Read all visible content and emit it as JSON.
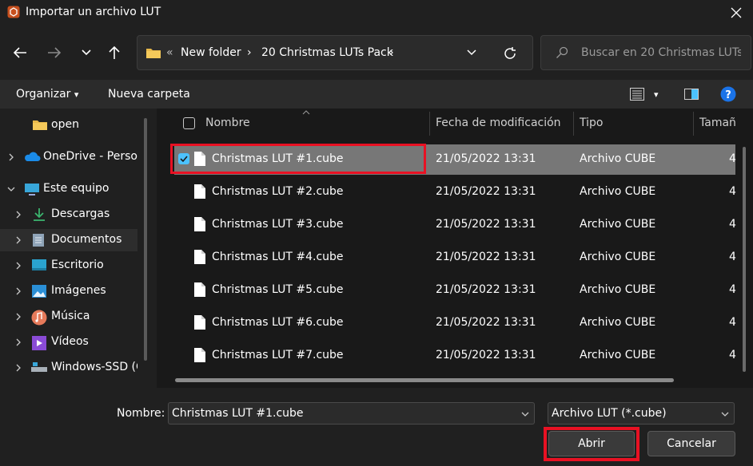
{
  "window": {
    "title": "Importar un archivo LUT",
    "icon": "app-logo-icon",
    "close_icon": "close-icon"
  },
  "nav": {
    "back_icon": "arrow-left-icon",
    "forward_icon": "arrow-right-icon",
    "recent_icon": "chevron-down-icon",
    "up_icon": "arrow-up-icon"
  },
  "address": {
    "overflow": "«",
    "crumbs": [
      "New folder",
      "20 Christmas LUTs Pack"
    ],
    "separator": "›",
    "dropdown_icon": "chevron-down-icon",
    "refresh_icon": "refresh-icon"
  },
  "search": {
    "placeholder": "Buscar en 20 Christmas LUTs ..."
  },
  "commands": {
    "organize": "Organizar",
    "organize_caret": "▾",
    "new_folder": "Nueva carpeta",
    "view_caret": "▾"
  },
  "sidebar": {
    "items": [
      {
        "label": "open",
        "icon": "folder-icon"
      },
      {
        "label": "OneDrive - Person",
        "icon": "cloud-icon"
      },
      {
        "label": "Este equipo",
        "icon": "computer-icon"
      },
      {
        "label": "Descargas",
        "icon": "download-icon"
      },
      {
        "label": "Documentos",
        "icon": "document-icon"
      },
      {
        "label": "Escritorio",
        "icon": "desktop-icon"
      },
      {
        "label": "Imágenes",
        "icon": "picture-icon"
      },
      {
        "label": "Música",
        "icon": "music-icon"
      },
      {
        "label": "Vídeos",
        "icon": "video-icon"
      },
      {
        "label": "Windows-SSD (C",
        "icon": "drive-icon"
      }
    ]
  },
  "files": {
    "columns": [
      "Nombre",
      "Fecha de modificación",
      "Tipo",
      "Tamañ"
    ],
    "rows": [
      {
        "name": "Christmas LUT #1.cube",
        "date": "21/05/2022 13:31",
        "type": "Archivo CUBE",
        "size": "4"
      },
      {
        "name": "Christmas LUT #2.cube",
        "date": "21/05/2022 13:31",
        "type": "Archivo CUBE",
        "size": "4"
      },
      {
        "name": "Christmas LUT #3.cube",
        "date": "21/05/2022 13:31",
        "type": "Archivo CUBE",
        "size": "4"
      },
      {
        "name": "Christmas LUT #4.cube",
        "date": "21/05/2022 13:31",
        "type": "Archivo CUBE",
        "size": "4"
      },
      {
        "name": "Christmas LUT #5.cube",
        "date": "21/05/2022 13:31",
        "type": "Archivo CUBE",
        "size": "4"
      },
      {
        "name": "Christmas LUT #6.cube",
        "date": "21/05/2022 13:31",
        "type": "Archivo CUBE",
        "size": "4"
      },
      {
        "name": "Christmas LUT #7.cube",
        "date": "21/05/2022 13:31",
        "type": "Archivo CUBE",
        "size": "4"
      }
    ]
  },
  "bottom": {
    "filename_label": "Nombre:",
    "filename_value": "Christmas LUT #1.cube",
    "filter_value": "Archivo LUT (*.cube)",
    "open_label": "Abrir",
    "cancel_label": "Cancelar"
  },
  "colors": {
    "background": "#202020",
    "selection": "#777777",
    "accent": "#4cc2ff",
    "highlight": "#e81123"
  }
}
